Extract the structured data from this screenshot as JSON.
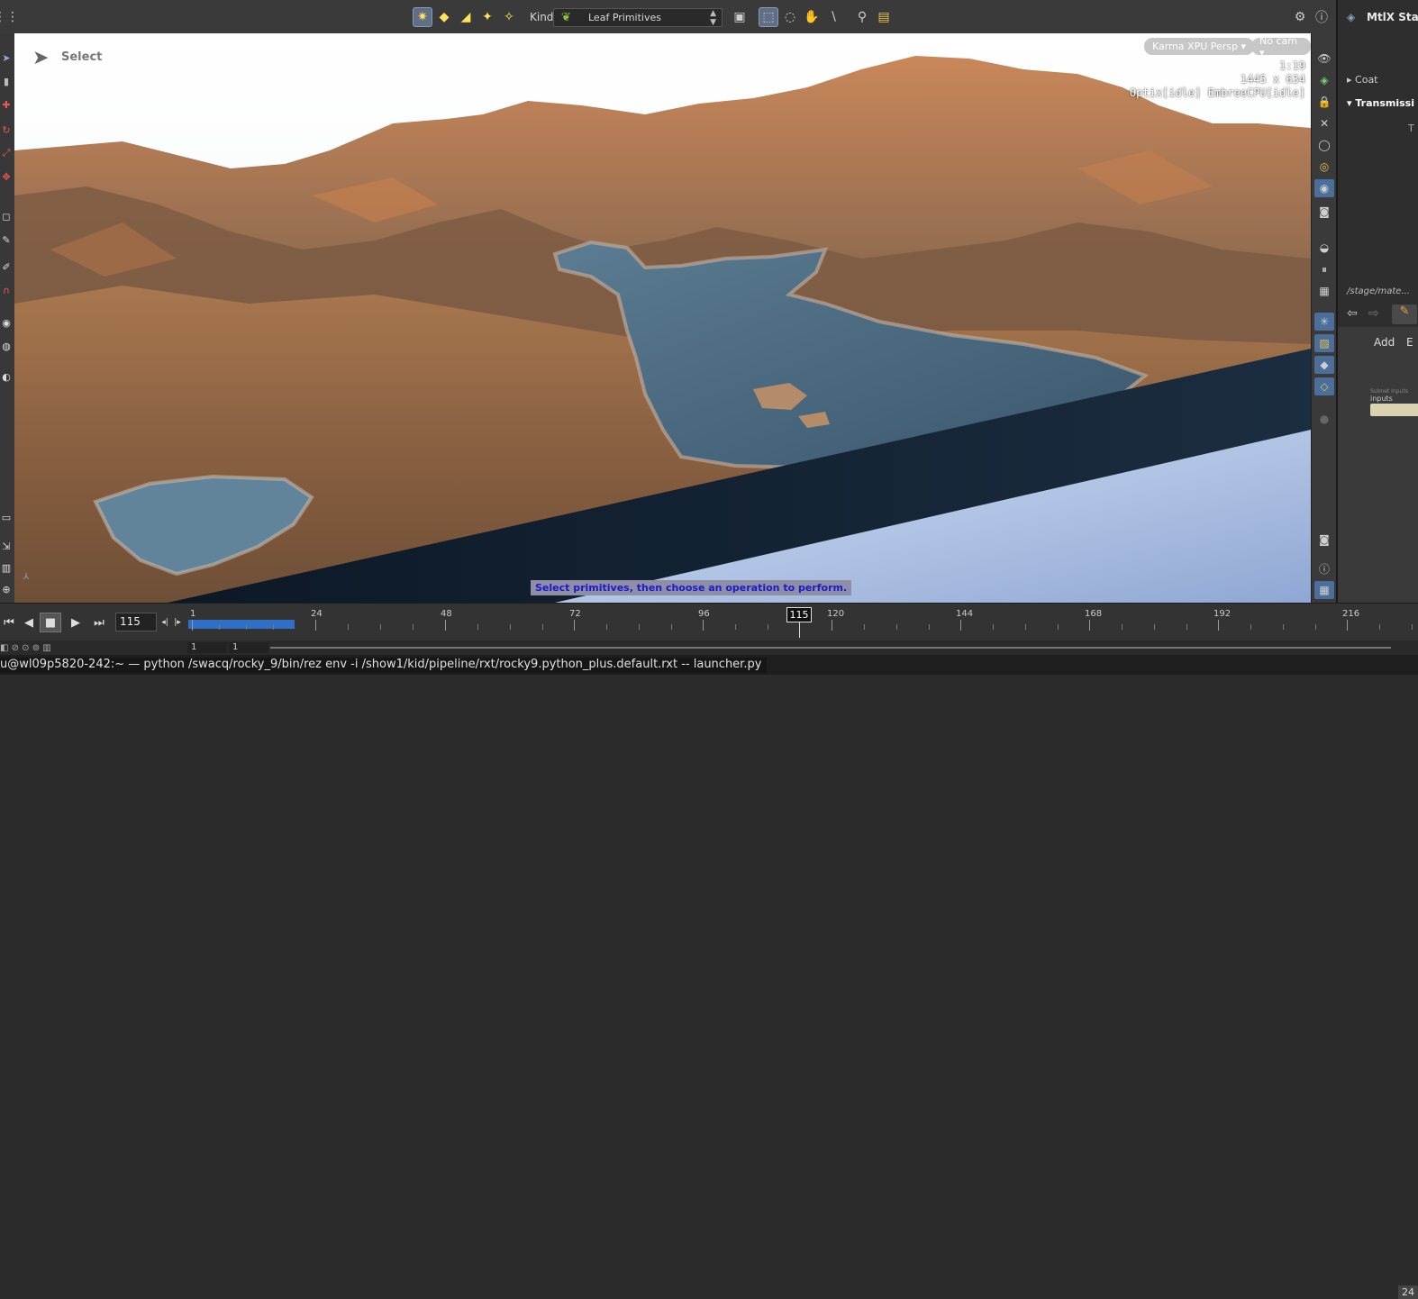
{
  "toolbar": {
    "kind_label": "Kind",
    "kind_value": "Leaf Primitives",
    "colors": {
      "accent": "#5f6f86",
      "selected_tool": "#8899b0"
    }
  },
  "viewport": {
    "mode_label": "Select",
    "renderer_pill": "Karma XPU  Persp ▾",
    "camera_pill": "No cam ▾",
    "hud": {
      "time": "1:19",
      "resolution": "1445 x 634",
      "engines": "Optix[idle] EmbreeCPU[idle]"
    },
    "status_message": "Select primitives, then choose an operation to perform."
  },
  "right_panel": {
    "title": "MtlX Stand",
    "rows": [
      "Coat",
      "Transmissi",
      "T"
    ],
    "path": "/stage/mate...",
    "add_label": "Add",
    "edit_label": "E",
    "node_label": "inputs",
    "node_sublabel": "Subnet Inputs"
  },
  "timeline": {
    "current_frame": "115",
    "ticks": [
      "1",
      "24",
      "48",
      "72",
      "96",
      "120",
      "144",
      "168",
      "192",
      "216"
    ],
    "playhead_label": "115",
    "range_start": "1",
    "range_end": "1",
    "end_frame": "24"
  },
  "statusbar": {
    "command": "u@wl09p5820-242:~ — python /swacq/rocky_9/bin/rez env -i /show1/kid/pipeline/rxt/rocky9.python_plus.default.rxt -- launcher.py"
  }
}
